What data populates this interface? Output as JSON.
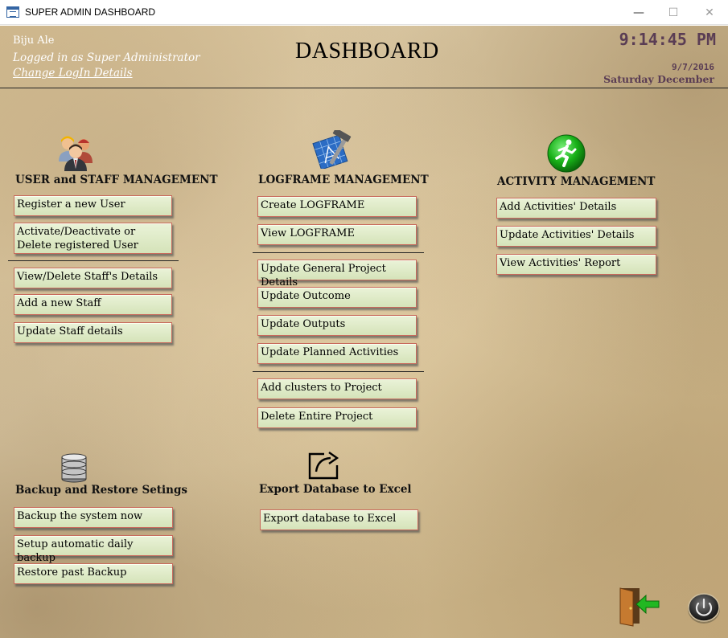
{
  "window": {
    "title": "SUPER ADMIN DASHBOARD"
  },
  "header": {
    "user_name": "Biju Ale",
    "user_role": "Logged in as Super Administrator",
    "change_login": "Change LogIn Details",
    "title": "DASHBOARD",
    "time": "9:14:45 PM",
    "date": "9/7/2016",
    "day": "Saturday December"
  },
  "user_staff": {
    "title": "USER and STAFF MANAGEMENT",
    "register": "Register a new User",
    "activate": "Activate/Deactivate or Delete registered User",
    "view_delete_staff": "View/Delete Staff's Details",
    "add_staff": "Add a new Staff",
    "update_staff": "Update Staff details"
  },
  "logframe": {
    "title": "LOGFRAME MANAGEMENT",
    "create": "Create LOGFRAME",
    "view": "View LOGFRAME",
    "update_general": "Update General Project Details",
    "update_outcome": "Update Outcome",
    "update_outputs": "Update Outputs",
    "update_planned": "Update Planned Activities",
    "add_clusters": "Add clusters to Project",
    "delete_project": "Delete Entire Project"
  },
  "activity": {
    "title": "ACTIVITY MANAGEMENT",
    "add": "Add  Activities' Details",
    "update": "Update  Activities' Details",
    "report": "View Activities' Report"
  },
  "backup": {
    "title": "Backup and Restore Setings",
    "backup_now": "Backup the system now",
    "setup_daily": "Setup automatic daily backup",
    "restore": "Restore past Backup"
  },
  "export": {
    "title": "Export Database to Excel",
    "button": "Export database to Excel"
  },
  "icons": {
    "users": "users-group-icon",
    "logframe": "blueprint-hammer-icon",
    "activity": "running-man-icon",
    "database": "database-icon",
    "export": "share-export-icon",
    "exit": "exit-door-icon",
    "power": "power-button-icon"
  },
  "colors": {
    "button_fill": "#dce8c4",
    "button_border": "#c86a5c",
    "clock": "#5a3d54"
  }
}
